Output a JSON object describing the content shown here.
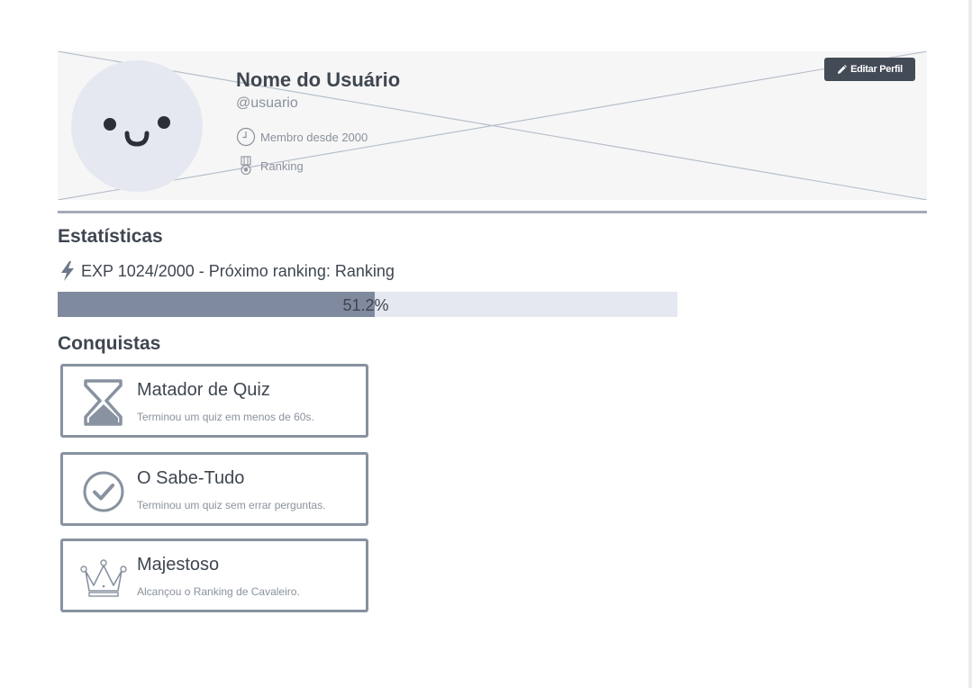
{
  "profile": {
    "name": "Nome do Usuário",
    "handle": "@usuario",
    "member_since": "Membro desde 2000",
    "rank": "Ranking",
    "edit_button_label": "Editar Perfil"
  },
  "stats": {
    "title": "Estatísticas",
    "exp_text": "EXP 1024/2000 - Próximo ranking: Ranking",
    "progress_percent": 51.2,
    "progress_label": "51.2%"
  },
  "achievements": {
    "title": "Conquistas",
    "items": [
      {
        "name": "Matador de Quiz",
        "description": "Terminou um quiz em menos de 60s.",
        "icon": "hourglass-icon"
      },
      {
        "name": "O Sabe-Tudo",
        "description": "Terminou um quiz sem errar perguntas.",
        "icon": "check-circle-icon"
      },
      {
        "name": "Majestoso",
        "description": "Alcançou o Ranking de Cavaleiro.",
        "icon": "crown-icon"
      }
    ]
  },
  "colors": {
    "header_background": "#f6f6f6",
    "avatar_background": "#e5e8f0",
    "button_background": "#434b57",
    "progress_fill": "#7f8a9e",
    "progress_track": "#e5e8f0",
    "card_border": "#8892a0",
    "text_primary": "#3f4650",
    "text_muted": "#8a919c"
  }
}
